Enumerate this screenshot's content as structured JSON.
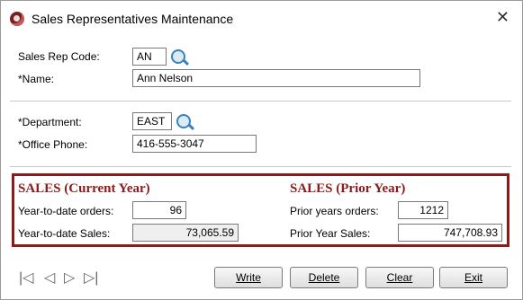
{
  "window": {
    "title": "Sales Representatives Maintenance",
    "close_glyph": "✕"
  },
  "rep": {
    "code_label": "Sales Rep Code:",
    "code_value": "AN",
    "name_label": "*Name:",
    "name_value": "Ann Nelson"
  },
  "dept": {
    "department_label": "*Department:",
    "department_value": "EAST",
    "phone_label": "*Office Phone:",
    "phone_value": "416-555-3047"
  },
  "sales_current": {
    "heading": "SALES (Current Year)",
    "orders_label": "Year-to-date orders:",
    "orders_value": "96",
    "sales_label": "Year-to-date Sales:",
    "sales_value": "73,065.59"
  },
  "sales_prior": {
    "heading": "SALES (Prior Year)",
    "orders_label": "Prior years orders:",
    "orders_value": "1212",
    "sales_label": "Prior Year Sales:",
    "sales_value": "747,708.93"
  },
  "navigation": {
    "first": "|◁",
    "prev": "◁",
    "next": "▷",
    "last": "▷|"
  },
  "buttons": {
    "write": "Write",
    "delete": "Delete",
    "clear": "Clear",
    "exit": "Exit"
  },
  "colors": {
    "accent": "#8b1a1a",
    "lookup": "#3c7fc0"
  },
  "icons": {
    "lookup": "search-icon",
    "app": "app-icon",
    "close": "close-icon"
  }
}
